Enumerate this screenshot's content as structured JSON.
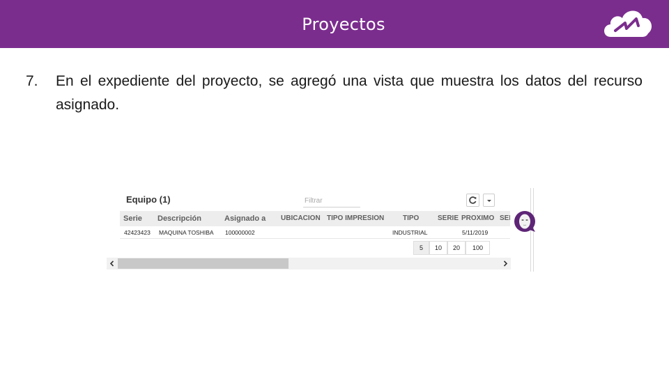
{
  "header": {
    "title": "Proyectos",
    "logo_icon": "cloud-logo-icon",
    "background": "#7b2d8e"
  },
  "step": {
    "number": "7.",
    "text": "En el expediente del proyecto, se agregó una vista que muestra los datos del recurso asignado."
  },
  "panel": {
    "title": "Equipo (1)",
    "filter_placeholder": "Filtrar",
    "columns": [
      "Serie",
      "Descripción",
      "Asignado a",
      "UBICACION",
      "TIPO IMPRESION",
      "TIPO",
      "SERIE",
      "PROXIMO",
      "SER"
    ],
    "rows": [
      [
        "42423423",
        "MAQUINA TOSHIBA",
        "100000002",
        "",
        "",
        "INDUSTRIAL",
        "",
        "5/11/2019",
        ""
      ]
    ],
    "page_sizes": [
      "5",
      "10",
      "20",
      "100"
    ],
    "selected_page_size": "5",
    "scrollbar": {
      "left_arrow": "<",
      "right_arrow": ">"
    }
  }
}
